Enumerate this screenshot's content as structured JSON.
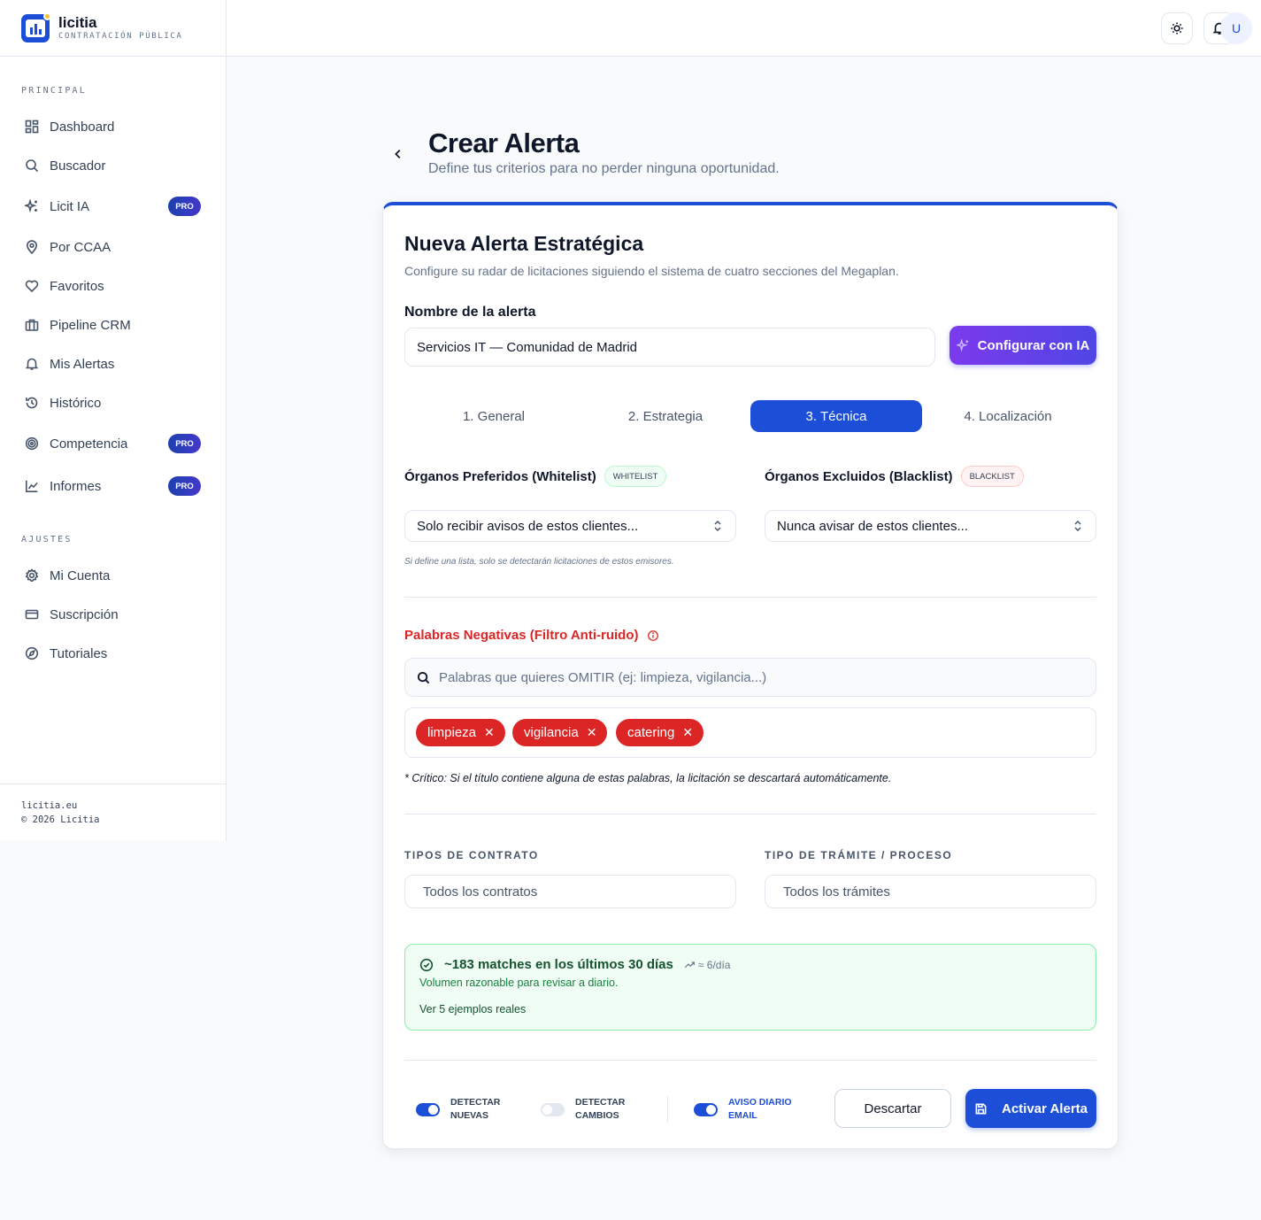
{
  "brand": {
    "name": "licitia",
    "tagline": "CONTRATACIÓN PÚBLICA"
  },
  "sidebar": {
    "sections": [
      "PRINCIPAL",
      "AJUSTES"
    ],
    "items": [
      {
        "label": "Dashboard",
        "icon": "dashboard-icon"
      },
      {
        "label": "Buscador",
        "icon": "search-icon"
      },
      {
        "label": "Licit IA",
        "icon": "sparkles-icon",
        "badge": "PRO"
      },
      {
        "label": "Por CCAA",
        "icon": "map-pin-icon"
      },
      {
        "label": "Favoritos",
        "icon": "heart-icon"
      },
      {
        "label": "Pipeline CRM",
        "icon": "briefcase-icon"
      },
      {
        "label": "Mis Alertas",
        "icon": "bell-icon"
      },
      {
        "label": "Histórico",
        "icon": "history-icon"
      },
      {
        "label": "Competencia",
        "icon": "target-icon",
        "badge": "PRO"
      },
      {
        "label": "Informes",
        "icon": "chart-line-icon",
        "badge": "PRO"
      },
      {
        "label": "Mi Cuenta",
        "icon": "gear-icon"
      },
      {
        "label": "Suscripción",
        "icon": "credit-card-icon"
      },
      {
        "label": "Tutoriales",
        "icon": "compass-icon"
      }
    ],
    "footer": {
      "site": "licitia.eu",
      "copyright": "© 2026 Licitia"
    }
  },
  "header": {
    "avatar_initial": "U"
  },
  "page": {
    "title": "Crear Alerta",
    "subtitle": "Define tus criterios para no perder ninguna oportunidad."
  },
  "card": {
    "title": "Nueva Alerta Estratégica",
    "subtitle": "Configure su radar de licitaciones siguiendo el sistema de cuatro secciones del Megaplan.",
    "name_label": "Nombre de la alerta",
    "name_value": "Servicios IT — Comunidad de Madrid",
    "ai_button": "Configurar con IA",
    "tabs": [
      "1. General",
      "2. Estrategia",
      "3. Técnica",
      "4. Localización"
    ],
    "whitelist": {
      "label": "Órganos Preferidos (Whitelist)",
      "badge": "WHITELIST",
      "placeholder": "Solo recibir avisos de estos clientes...",
      "hint": "Si define una lista, solo se detectarán licitaciones de estos emisores."
    },
    "blacklist": {
      "label": "Órganos Excluidos (Blacklist)",
      "badge": "BLACKLIST",
      "placeholder": "Nunca avisar de estos clientes..."
    },
    "negative": {
      "label": "Palabras Negativas (Filtro Anti-ruido)",
      "placeholder": "Palabras que quieres OMITIR (ej: limpieza, vigilancia...)",
      "tags": [
        "limpieza",
        "vigilancia",
        "catering"
      ],
      "note": "* Crítico: Si el título contiene alguna de estas palabras, la licitación se descartará automáticamente."
    },
    "contract_types": {
      "label": "TIPOS DE CONTRATO",
      "value": "Todos los contratos"
    },
    "procedure_types": {
      "label": "TIPO DE TRÁMITE / PROCESO",
      "value": "Todos los trámites"
    },
    "matches": {
      "headline": "~183 matches en los últimos 30 días",
      "rate": "≈ 6/día",
      "description": "Volumen razonable para revisar a diario.",
      "link": "Ver 5 ejemplos reales"
    },
    "toggles": [
      {
        "line1": "DETECTAR",
        "line2": "NUEVAS",
        "on": true
      },
      {
        "line1": "DETECTAR",
        "line2": "CAMBIOS",
        "on": false
      },
      {
        "line1": "AVISO DIARIO",
        "line2": "EMAIL",
        "on": true
      }
    ],
    "discard_button": "Descartar",
    "activate_button": "Activar Alerta"
  },
  "colors": {
    "primary": "#1d4ed8",
    "danger": "#dc2626",
    "success": "#16a34a",
    "ai": "#7c3aed"
  }
}
